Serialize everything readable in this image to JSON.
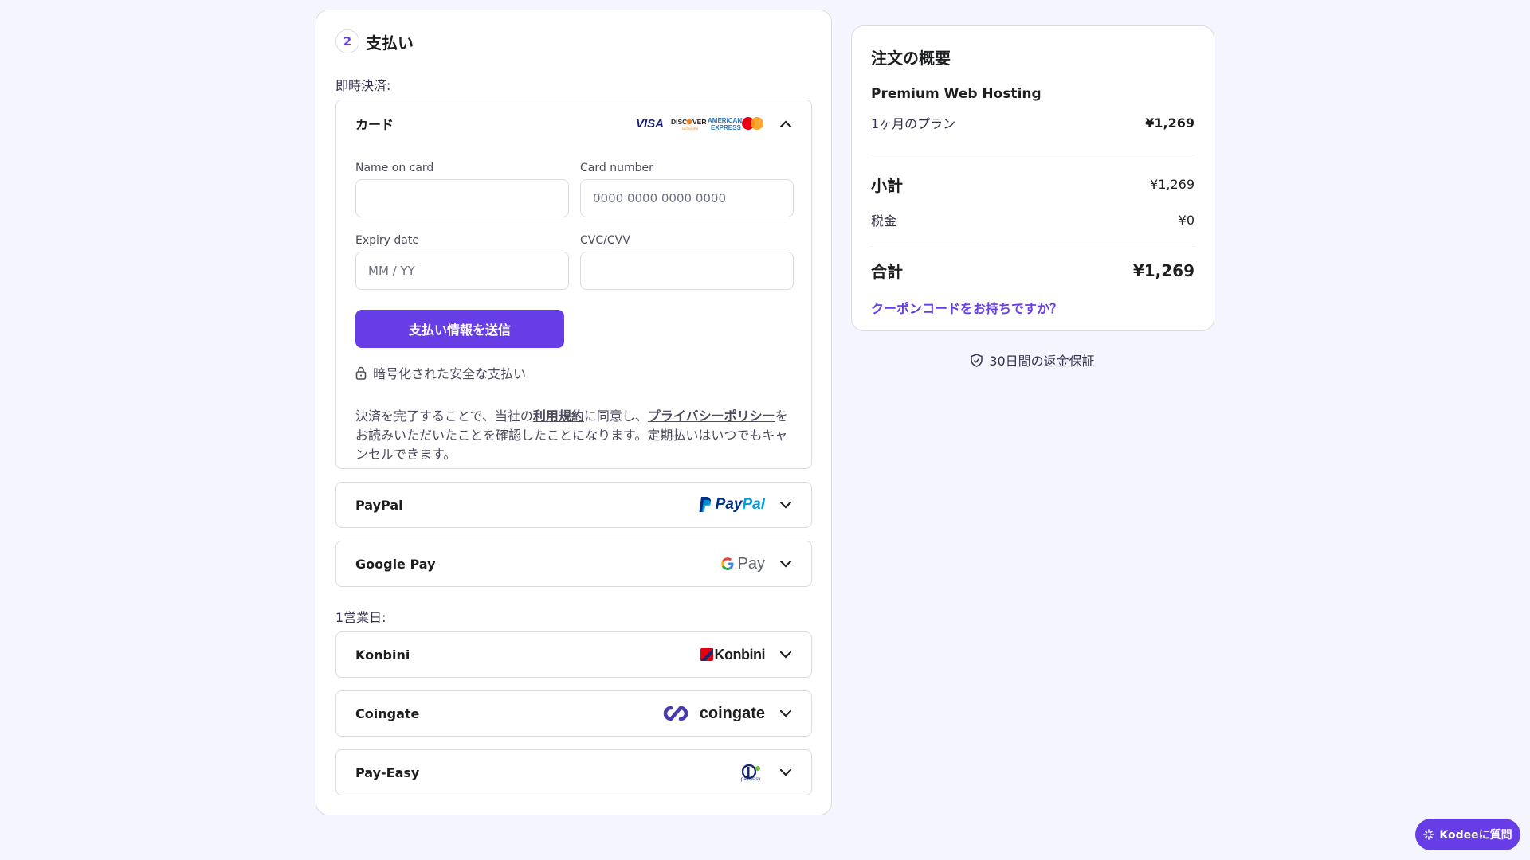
{
  "payment": {
    "step_number": "2",
    "step_title": "支払い",
    "instant_label": "即時決済:",
    "business_day_label": "1営業日:",
    "card": {
      "name": "カード",
      "logos": [
        "VISA",
        "DISCOVER",
        "AMERICAN EXPRESS",
        "mastercard"
      ],
      "name_label": "Name on card",
      "name_placeholder": "",
      "number_label": "Card number",
      "number_placeholder": "0000 0000 0000 0000",
      "expiry_label": "Expiry date",
      "expiry_placeholder": "MM / YY",
      "cvc_label": "CVC/CVV",
      "cvc_placeholder": "",
      "submit_label": "支払い情報を送信",
      "secure_text": "暗号化された安全な支払い",
      "terms_1": "決済を完了することで、当社の",
      "terms_link_1": "利用規約",
      "terms_2": "に同意し、",
      "terms_link_2": "プライバシーポリシー",
      "terms_3": "をお読みいただいたことを確認したことになります。定期払いはいつでもキャンセルできます。"
    },
    "methods": [
      {
        "name": "PayPal",
        "logo_text_1": "Pay",
        "logo_text_2": "Pal"
      },
      {
        "name": "Google Pay",
        "logo_text": "Pay"
      },
      {
        "name": "Konbini",
        "logo_text": "Konbini"
      },
      {
        "name": "Coingate",
        "logo_text": "coingate"
      },
      {
        "name": "Pay-Easy",
        "logo_text": "pay-easy"
      }
    ]
  },
  "summary": {
    "title": "注文の概要",
    "product": "Premium Web Hosting",
    "plan_label": "1ヶ月のプラン",
    "plan_price": "¥1,269",
    "subtotal_label": "小計",
    "subtotal_value": "¥1,269",
    "tax_label": "税金",
    "tax_value": "¥0",
    "total_label": "合計",
    "total_value": "¥1,269",
    "coupon_link": "クーポンコードをお持ちですか？",
    "guarantee": "30日間の返金保証"
  },
  "assistant": {
    "button_label": "Kodeeに質問"
  },
  "colors": {
    "accent": "#673de6",
    "background": "#f4f5ff",
    "text_dark": "#1d1e20",
    "border": "#dadce0"
  }
}
